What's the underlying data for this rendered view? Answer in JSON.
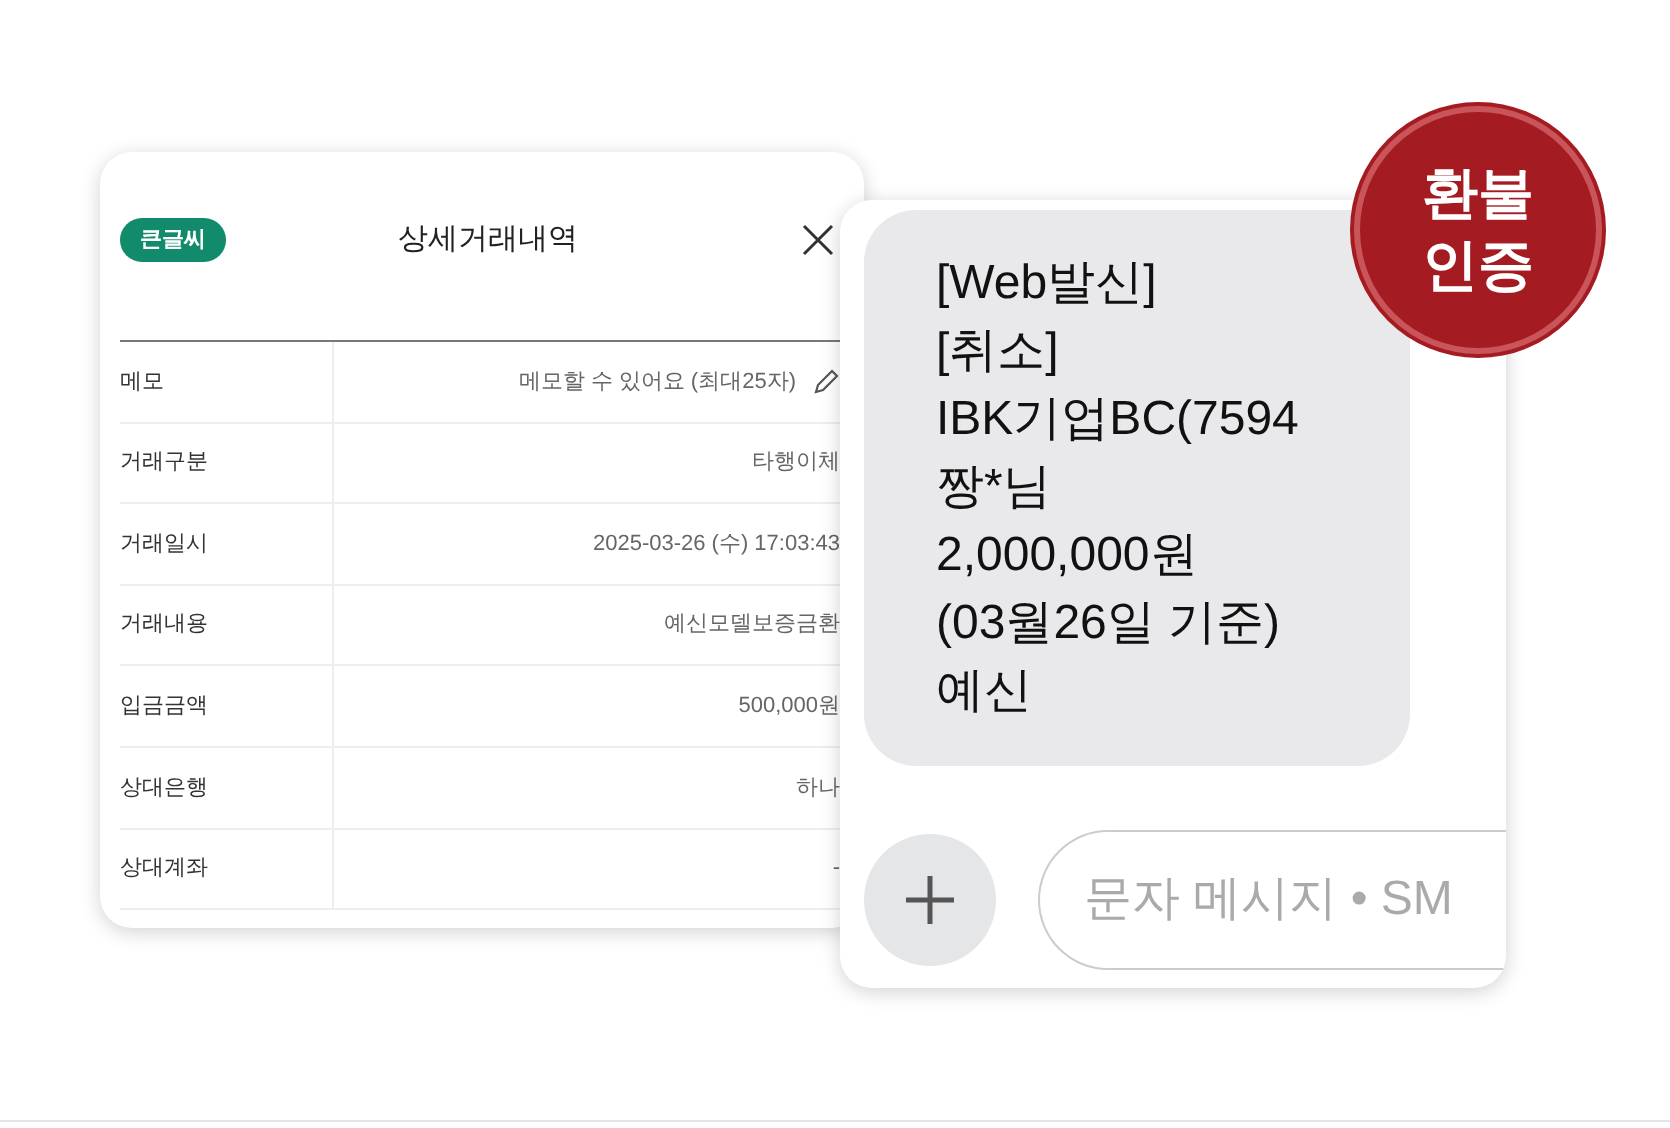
{
  "detail_card": {
    "badge": "큰글씨",
    "title": "상세거래내역",
    "rows": [
      {
        "label": "메모",
        "value": "메모할 수 있어요 (최대25자)",
        "kind": "editable"
      },
      {
        "label": "거래구분",
        "value": "타행이체",
        "kind": "plain"
      },
      {
        "label": "거래일시",
        "value": "2025-03-26 (수) 17:03:43",
        "kind": "plain"
      },
      {
        "label": "거래내용",
        "value": "예신모델보증금환",
        "kind": "plain"
      },
      {
        "label": "입금금액",
        "value": "500,000원",
        "kind": "plain"
      },
      {
        "label": "상대은행",
        "value": "하나",
        "kind": "plain"
      },
      {
        "label": "상대계좌",
        "value": "-",
        "kind": "plain"
      }
    ]
  },
  "message_card": {
    "message_lines": [
      "[Web발신]",
      "[취소]",
      "IBK기업BC(7594",
      "짱*님",
      "2,000,000원",
      "(03월26일 기준)",
      "예신"
    ],
    "input": {
      "placeholder": "문자 메시지 • SM"
    }
  },
  "stamp": {
    "lines": [
      "환불",
      "인증"
    ]
  }
}
